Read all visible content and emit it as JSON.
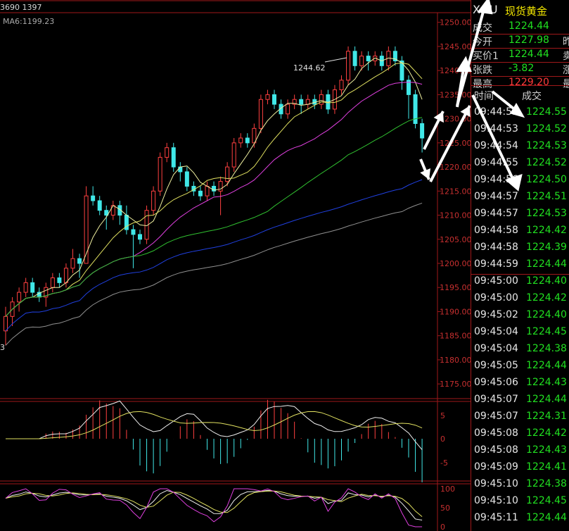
{
  "header": {
    "code": "XAU",
    "name": "现货黄金"
  },
  "top_info": "3690 1397",
  "ma_label": "MA6:1199.23",
  "quote_rows": [
    {
      "label": "成交",
      "value": "1224.44",
      "color": "g",
      "extra": ""
    },
    {
      "label": "今开",
      "value": "1227.98",
      "color": "g",
      "extra": "昨"
    },
    {
      "label": "买价1",
      "value": "1224.44",
      "color": "g",
      "extra": "卖"
    },
    {
      "label": "张跌",
      "value": "-3.82",
      "color": "g",
      "extra": "涨"
    },
    {
      "label": "最高",
      "value": "1229.20",
      "color": "r",
      "extra": "最"
    }
  ],
  "ticks_header": {
    "time": "时间",
    "deal": "成交"
  },
  "ticks": [
    {
      "time": "09:44:53",
      "price": "1224.55"
    },
    {
      "time": "09:44:53",
      "price": "1224.52"
    },
    {
      "time": "09:44:54",
      "price": "1224.53"
    },
    {
      "time": "09:44:55",
      "price": "1224.52"
    },
    {
      "time": "09:44:56",
      "price": "1224.50"
    },
    {
      "time": "09:44:57",
      "price": "1224.51"
    },
    {
      "time": "09:44:57",
      "price": "1224.53"
    },
    {
      "time": "09:44:58",
      "price": "1224.42"
    },
    {
      "time": "09:44:58",
      "price": "1224.39"
    },
    {
      "time": "09:44:59",
      "price": "1224.44"
    },
    {
      "time": "09:45:00",
      "price": "1224.40"
    },
    {
      "time": "09:45:00",
      "price": "1224.42"
    },
    {
      "time": "09:45:02",
      "price": "1224.40"
    },
    {
      "time": "09:45:04",
      "price": "1224.45"
    },
    {
      "time": "09:45:04",
      "price": "1224.38"
    },
    {
      "time": "09:45:05",
      "price": "1224.44"
    },
    {
      "time": "09:45:06",
      "price": "1224.43"
    },
    {
      "time": "09:45:07",
      "price": "1224.44"
    },
    {
      "time": "09:45:07",
      "price": "1224.31"
    },
    {
      "time": "09:45:08",
      "price": "1224.42"
    },
    {
      "time": "09:45:08",
      "price": "1224.43"
    },
    {
      "time": "09:45:09",
      "price": "1224.41"
    },
    {
      "time": "09:45:10",
      "price": "1224.38"
    },
    {
      "time": "09:45:10",
      "price": "1224.45"
    },
    {
      "time": "09:45:11",
      "price": "1224.44"
    }
  ],
  "chart_data": {
    "type": "candlestick",
    "price_ylim": [
      1174,
      1252
    ],
    "y_ticks": [
      "1250.00",
      "1245.00",
      "1240.00",
      "1235.00",
      "1230.00",
      "1225.00",
      "1220.00",
      "1215.00",
      "1210.00",
      "1205.00",
      "1200.00",
      "1195.00",
      "1190.00",
      "1185.00",
      "1180.00",
      "1175.00"
    ],
    "y_tick_values": [
      1250,
      1245,
      1240,
      1235,
      1230,
      1225,
      1220,
      1215,
      1210,
      1205,
      1200,
      1195,
      1190,
      1185,
      1180,
      1175
    ],
    "high_annotation": "1244.62",
    "low_annotation_fragment": "3",
    "candles": [
      [
        1186,
        1189,
        1183,
        1191
      ],
      [
        1189,
        1192,
        1187,
        1193
      ],
      [
        1192,
        1194,
        1190,
        1195
      ],
      [
        1194,
        1196,
        1193,
        1197
      ],
      [
        1196,
        1194,
        1193,
        1197
      ],
      [
        1194,
        1193,
        1192,
        1195
      ],
      [
        1193,
        1195,
        1191,
        1196
      ],
      [
        1195,
        1197,
        1194,
        1198
      ],
      [
        1197,
        1196,
        1195,
        1198
      ],
      [
        1196,
        1199,
        1195,
        1200
      ],
      [
        1199,
        1201,
        1198,
        1203
      ],
      [
        1201,
        1200,
        1197,
        1202
      ],
      [
        1200,
        1214,
        1200,
        1216
      ],
      [
        1214,
        1213,
        1212,
        1216
      ],
      [
        1213,
        1211,
        1210,
        1214
      ],
      [
        1211,
        1210,
        1207,
        1212
      ],
      [
        1210,
        1212,
        1209,
        1213
      ],
      [
        1212,
        1210,
        1208,
        1213
      ],
      [
        1210,
        1207,
        1206,
        1212
      ],
      [
        1207,
        1206,
        1199,
        1208
      ],
      [
        1206,
        1205,
        1204,
        1207
      ],
      [
        1205,
        1211,
        1204,
        1212
      ],
      [
        1211,
        1215,
        1210,
        1216
      ],
      [
        1215,
        1222,
        1214,
        1223
      ],
      [
        1222,
        1224,
        1221,
        1225
      ],
      [
        1224,
        1220,
        1219,
        1225
      ],
      [
        1220,
        1219,
        1217,
        1221
      ],
      [
        1219,
        1216,
        1215,
        1220
      ],
      [
        1216,
        1215,
        1214,
        1217
      ],
      [
        1215,
        1214,
        1213,
        1216
      ],
      [
        1214,
        1216,
        1213,
        1217
      ],
      [
        1216,
        1215,
        1214,
        1217
      ],
      [
        1215,
        1217,
        1210,
        1218
      ],
      [
        1217,
        1220,
        1216,
        1221
      ],
      [
        1220,
        1225,
        1219,
        1226
      ],
      [
        1225,
        1226,
        1224,
        1227
      ],
      [
        1226,
        1225,
        1224,
        1227
      ],
      [
        1225,
        1228,
        1224,
        1229
      ],
      [
        1228,
        1234,
        1227,
        1235
      ],
      [
        1234,
        1235,
        1233,
        1236
      ],
      [
        1235,
        1233,
        1232,
        1236
      ],
      [
        1233,
        1231,
        1230,
        1234
      ],
      [
        1231,
        1233,
        1230,
        1234
      ],
      [
        1233,
        1234,
        1232,
        1235
      ],
      [
        1234,
        1233,
        1231,
        1235
      ],
      [
        1233,
        1234,
        1232,
        1235
      ],
      [
        1234,
        1233,
        1232,
        1235
      ],
      [
        1233,
        1235,
        1232,
        1236
      ],
      [
        1235,
        1232,
        1231,
        1236
      ],
      [
        1232,
        1236,
        1231,
        1237
      ],
      [
        1236,
        1238,
        1235,
        1239
      ],
      [
        1238,
        1244,
        1237,
        1245
      ],
      [
        1244,
        1241,
        1240,
        1245
      ],
      [
        1241,
        1243,
        1240,
        1244
      ],
      [
        1243,
        1242,
        1240,
        1244
      ],
      [
        1242,
        1243,
        1241,
        1244
      ],
      [
        1243,
        1241,
        1240,
        1244
      ],
      [
        1241,
        1244,
        1240,
        1245
      ],
      [
        1244,
        1242,
        1241,
        1245
      ],
      [
        1242,
        1238,
        1236,
        1243
      ],
      [
        1238,
        1235,
        1230,
        1239
      ],
      [
        1235,
        1229,
        1228,
        1236
      ],
      [
        1229,
        1226,
        1223,
        1230
      ]
    ]
  }
}
